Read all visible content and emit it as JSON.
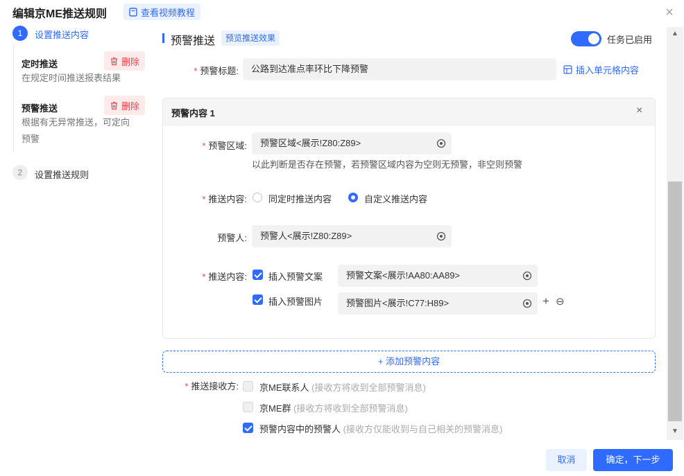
{
  "dialog": {
    "title": "编辑京ME推送规则",
    "video_tutorial": "查看视频教程",
    "close": "×"
  },
  "steps": {
    "step1": {
      "number": "1",
      "label": "设置推送内容"
    },
    "step2": {
      "number": "2",
      "label": "设置推送规则"
    },
    "items": [
      {
        "title": "定时推送",
        "desc": "在规定时间推送报表结果",
        "delete": "删除"
      },
      {
        "title": "预警推送",
        "desc_line1": "根据有无异常推送，可定向",
        "desc_line2": "预警",
        "delete": "删除"
      }
    ]
  },
  "section": {
    "title": "预警推送",
    "preview": "预览推送效果",
    "toggle_label": "任务已启用",
    "toggle_on": true
  },
  "warning_title": {
    "label": "预警标题:",
    "value": "公路到达准点率环比下降预警",
    "insert_cell": "插入单元格内容"
  },
  "card": {
    "title": "预警内容 1",
    "close": "×",
    "area": {
      "label": "预警区域:",
      "value": "预警区域<展示!Z80:Z89>",
      "hint": "以此判断是否存在预警，若预警区域内容为空则无预警，非空则预警"
    },
    "push_content": {
      "label": "推送内容:",
      "option1": "同定时推送内容",
      "option2": "自定义推送内容",
      "selected": "option2"
    },
    "warner": {
      "label": "预警人:",
      "value": "预警人<展示!Z80:Z89>"
    },
    "push_content2": {
      "label": "推送内容:",
      "insert_text_label": "插入预警文案",
      "insert_text_value": "预警文案<展示!AA80:AA89>",
      "insert_image_label": "插入预警图片",
      "insert_image_value": "预警图片<展示!C77:H89>",
      "plus": "+",
      "minus": "⊖"
    }
  },
  "add_content": "+ 添加预警内容",
  "receivers": {
    "label": "推送接收方:",
    "options": [
      {
        "name": "京ME联系人",
        "note": "(接收方将收到全部预警消息)",
        "checked": false
      },
      {
        "name": "京ME群",
        "note": "(接收方将收到全部预警消息)",
        "checked": false
      },
      {
        "name": "预警内容中的预警人",
        "note": "(接收方仅能收到与自己相关的预警消息)",
        "checked": true
      }
    ]
  },
  "footer": {
    "cancel": "取消",
    "confirm": "确定，下一步"
  },
  "colors": {
    "primary": "#2f6bff",
    "danger": "#e5484d",
    "input_bg": "#f2f2f2"
  }
}
